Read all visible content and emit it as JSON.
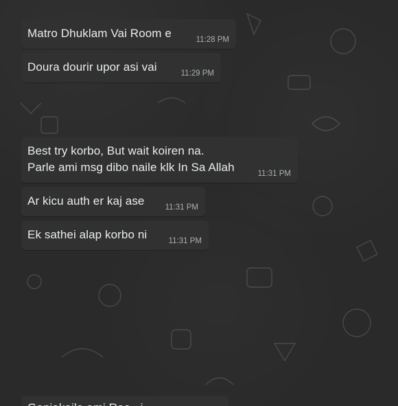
{
  "conversation": {
    "messages": [
      {
        "text": "Matro Dhuklam Vai Room e",
        "time": "11:28 PM"
      },
      {
        "text": "Doura dourir upor asi vai",
        "time": "11:29 PM"
      },
      {
        "text": "Best try korbo, But wait koiren na.\nParle ami msg dibo naile klk In Sa Allah",
        "time": "11:31 PM"
      },
      {
        "text": "Ar kicu auth er kaj ase",
        "time": "11:31 PM"
      },
      {
        "text": "Ek sathei alap korbo ni",
        "time": "11:31 PM"
      },
      {
        "text": "Ganjakaile ami Rea...i",
        "time": ""
      }
    ]
  }
}
